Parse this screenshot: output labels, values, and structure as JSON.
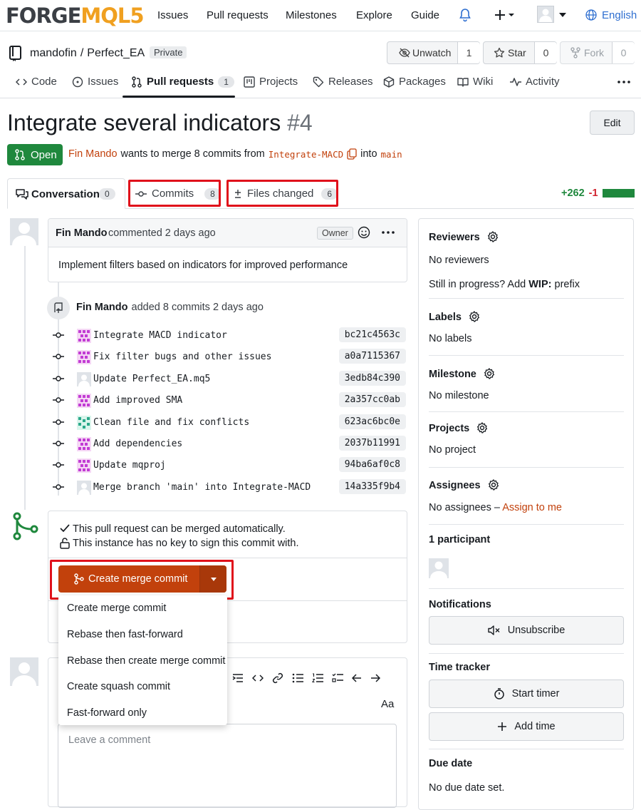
{
  "nav": {
    "logo_a": "FORGE",
    "logo_b": "MQL5",
    "items": [
      "Issues",
      "Pull requests",
      "Milestones",
      "Explore",
      "Guide"
    ],
    "language": "English"
  },
  "repo": {
    "owner": "mandofin",
    "separator": "/",
    "name": "Perfect_EA",
    "visibility": "Private",
    "unwatch_label": "Unwatch",
    "unwatch_count": "1",
    "star_label": "Star",
    "star_count": "0",
    "fork_label": "Fork",
    "fork_count": "0"
  },
  "repo_tabs": {
    "code": "Code",
    "issues": "Issues",
    "pulls": "Pull requests",
    "pulls_count": "1",
    "projects": "Projects",
    "releases": "Releases",
    "packages": "Packages",
    "wiki": "Wiki",
    "activity": "Activity"
  },
  "pr": {
    "title": "Integrate several indicators",
    "number": "#4",
    "edit_label": "Edit",
    "state": "Open",
    "author": "Fin Mando",
    "merge_text": "wants to merge 8 commits from",
    "head_branch": "Integrate-MACD",
    "into_text": "into",
    "base_branch": "main"
  },
  "pr_tabs": {
    "conversation": "Conversation",
    "conversation_count": "0",
    "commits": "Commits",
    "commits_count": "8",
    "files": "Files changed",
    "files_count": "6",
    "additions": "+262",
    "deletions": "-1"
  },
  "comment": {
    "author": "Fin Mando",
    "meta": "commented 2 days ago",
    "role": "Owner",
    "body": "Implement filters based on indicators for improved performance"
  },
  "push_event": {
    "author": "Fin Mando",
    "text": "added 8 commits 2 days ago"
  },
  "commits": [
    {
      "message": "Integrate MACD indicator",
      "sha": "bc21c4563c",
      "avatar": "pink"
    },
    {
      "message": "Fix filter bugs and other issues",
      "sha": "a0a7115367",
      "avatar": "pink"
    },
    {
      "message": "Update Perfect_EA.mq5",
      "sha": "3edb84c390",
      "avatar": "plain"
    },
    {
      "message": "Add improved SMA",
      "sha": "2a357cc0ab",
      "avatar": "pink"
    },
    {
      "message": "Clean file and fix conflicts",
      "sha": "623ac6bc0e",
      "avatar": "green"
    },
    {
      "message": "Add dependencies",
      "sha": "2037b11991",
      "avatar": "pink"
    },
    {
      "message": "Update mqproj",
      "sha": "94ba6af0c8",
      "avatar": "pink"
    },
    {
      "message": "Merge branch 'main' into Integrate-MACD",
      "sha": "14a335f9b4",
      "avatar": "plain"
    }
  ],
  "merge_box": {
    "status_ok": "This pull request can be merged automatically.",
    "status_key": "This instance has no key to sign this commit with.",
    "button_label": "Create merge commit",
    "options": [
      "Create merge commit",
      "Rebase then fast-forward",
      "Rebase then create merge commit",
      "Create squash commit",
      "Fast-forward only"
    ]
  },
  "editor": {
    "font_toggle": "Aa",
    "placeholder": "Leave a comment"
  },
  "sidebar": {
    "reviewers_title": "Reviewers",
    "reviewers_value": "No reviewers",
    "wip_prefix": "Still in progress? Add",
    "wip_bold": "WIP:",
    "wip_suffix": "prefix",
    "labels_title": "Labels",
    "labels_value": "No labels",
    "milestone_title": "Milestone",
    "milestone_value": "No milestone",
    "projects_title": "Projects",
    "projects_value": "No project",
    "assignees_title": "Assignees",
    "assignees_value": "No assignees –",
    "assign_link": "Assign to me",
    "participants_title": "1 participant",
    "notifications_title": "Notifications",
    "unsubscribe_label": "Unsubscribe",
    "time_tracker_title": "Time tracker",
    "start_timer_label": "Start timer",
    "add_time_label": "Add time",
    "due_date_title": "Due date",
    "due_date_value": "No due date set."
  },
  "colors": {
    "accent": "#c2410c",
    "merge_button": "#c2410c",
    "open_badge": "#1f883d",
    "highlight": "#e0111b"
  }
}
